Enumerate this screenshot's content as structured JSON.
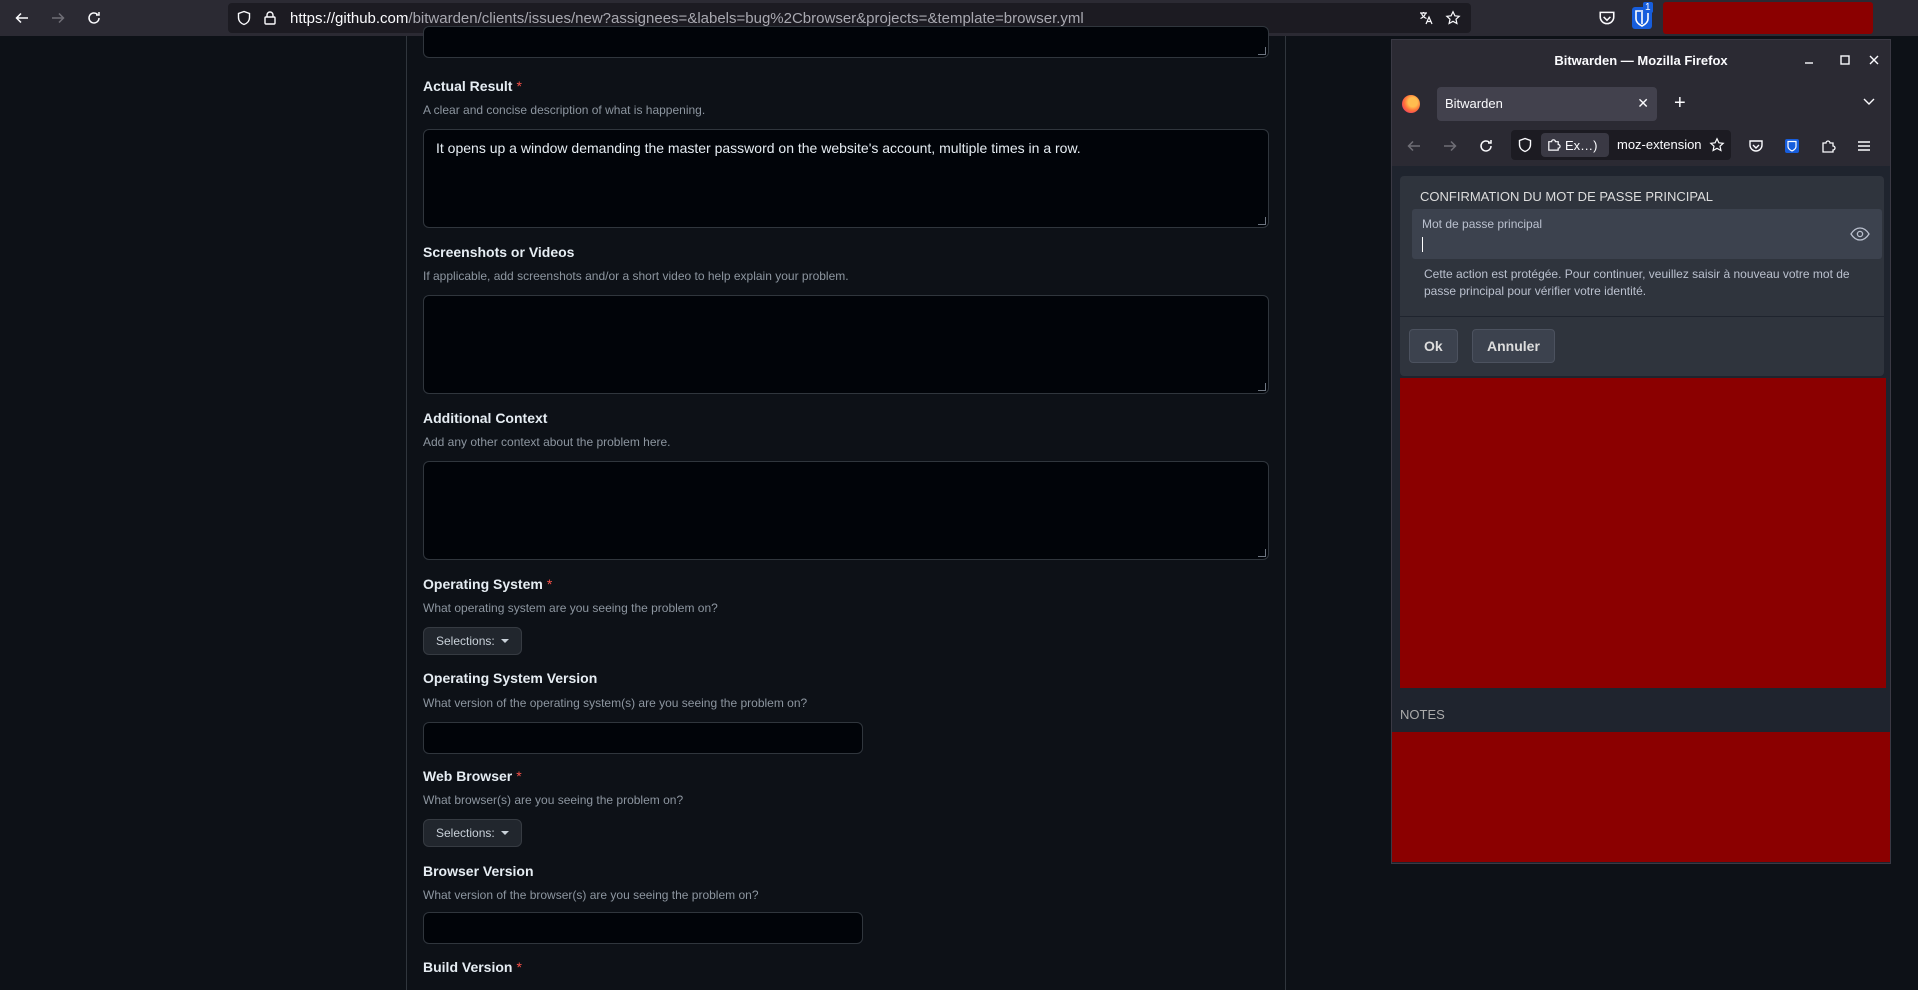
{
  "browser": {
    "url_host": "https://github.com",
    "url_path": "/bitwarden/clients/issues/new?assignees=&labels=bug%2Cbrowser&projects=&template=browser.yml",
    "ext_badge": "1"
  },
  "form": {
    "actual_result": {
      "label": "Actual Result",
      "required": "*",
      "description": "A clear and concise description of what is happening.",
      "value": "It opens up a window demanding the master password on the website's account, multiple times in a row."
    },
    "screenshots": {
      "label": "Screenshots or Videos",
      "description": "If applicable, add screenshots and/or a short video to help explain your problem."
    },
    "additional_context": {
      "label": "Additional Context",
      "description": "Add any other context about the problem here."
    },
    "operating_system": {
      "label": "Operating System",
      "required": "*",
      "description": "What operating system are you seeing the problem on?",
      "select_label": "Selections:"
    },
    "os_version": {
      "label": "Operating System Version",
      "description": "What version of the operating system(s) are you seeing the problem on?"
    },
    "web_browser": {
      "label": "Web Browser",
      "required": "*",
      "description": "What browser(s) are you seeing the problem on?",
      "select_label": "Selections:"
    },
    "browser_version": {
      "label": "Browser Version",
      "description": "What version of the browser(s) are you seeing the problem on?"
    },
    "build_version": {
      "label": "Build Version",
      "required": "*"
    }
  },
  "popup": {
    "window_title": "Bitwarden — Mozilla Firefox",
    "tab_label": "Bitwarden",
    "ext_chip": "Ex…)",
    "url_text": "moz-extension",
    "dialog": {
      "title": "CONFIRMATION DU MOT DE PASSE PRINCIPAL",
      "field_label": "Mot de passe principal",
      "help": "Cette action est protégée. Pour continuer, veuillez saisir à nouveau votre mot de passe principal pour vérifier votre identité.",
      "ok": "Ok",
      "cancel": "Annuler"
    },
    "notes_label": "NOTES",
    "colors": {
      "redacted": "#8b0000",
      "bitwarden_blue": "#175ddc"
    }
  }
}
